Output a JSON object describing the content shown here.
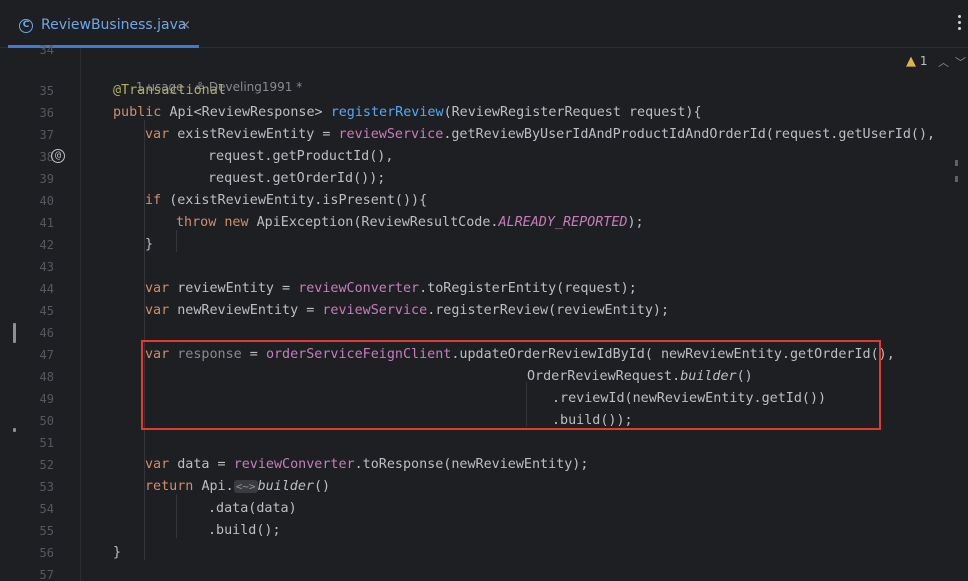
{
  "tab": {
    "label": "ReviewBusiness.java",
    "icon": "class-c-icon",
    "close": "×"
  },
  "meta": {
    "usage": "1 usage",
    "author": "Develing1991 *"
  },
  "warnings": {
    "count": "1"
  },
  "line_numbers": [
    "34",
    "35",
    "36",
    "37",
    "38",
    "39",
    "40",
    "41",
    "42",
    "43",
    "44",
    "45",
    "46",
    "47",
    "48",
    "49",
    "50",
    "51",
    "52",
    "53",
    "54",
    "55",
    "56",
    "57"
  ],
  "code": {
    "annotation": "@Transactional",
    "sig_kw": "public ",
    "sig_type": "Api<ReviewResponse> ",
    "sig_fn": "registerReview",
    "sig_rest": "(ReviewRegisterRequest request){",
    "l37_kw": "var ",
    "l37_a": "existReviewEntity = ",
    "l37_f": "reviewService",
    "l37_b": ".getReviewByUserIdAndProductIdAndOrderId(request.getUserId(),",
    "l38": "request.getProductId(),",
    "l39": "request.getOrderId());",
    "l40_kw": "if ",
    "l40_rest": "(existReviewEntity.isPresent()){",
    "l41_kw1": "throw ",
    "l41_kw2": "new ",
    "l41_a": "ApiException(ReviewResultCode.",
    "l41_const": "ALREADY_REPORTED",
    "l41_b": ");",
    "l42": "}",
    "l44_kw": "var ",
    "l44_a": "reviewEntity = ",
    "l44_f": "reviewConverter",
    "l44_b": ".toRegisterEntity(request);",
    "l45_kw": "var ",
    "l45_a": "newReviewEntity = ",
    "l45_f": "reviewService",
    "l45_b": ".registerReview(reviewEntity);",
    "l47_kw": "var ",
    "l47_var": "response",
    "l47_eq": " = ",
    "l47_f": "orderServiceFeignClient",
    "l47_b": ".updateOrderReviewIdById( newReviewEntity.getOrderId(),",
    "l48_a": "OrderReviewRequest.",
    "l48_it": "builder",
    "l48_b": "()",
    "l49": ".reviewId(newReviewEntity.getId())",
    "l50": ".build());",
    "l52_kw": "var ",
    "l52_a": "data = ",
    "l52_f": "reviewConverter",
    "l52_b": ".toResponse(newReviewEntity);",
    "l53_kw": "return ",
    "l53_a": "Api.",
    "l53_hint": "<~>",
    "l53_it": "builder",
    "l53_b": "()",
    "l54": ".data(data)",
    "l55": ".build();",
    "l56": "}"
  },
  "colors": {
    "keyword": "#cf8e6d",
    "function": "#56a8f5",
    "field": "#c77dbb",
    "annotation": "#b3ae60",
    "highlight_border": "#e23b2e"
  }
}
